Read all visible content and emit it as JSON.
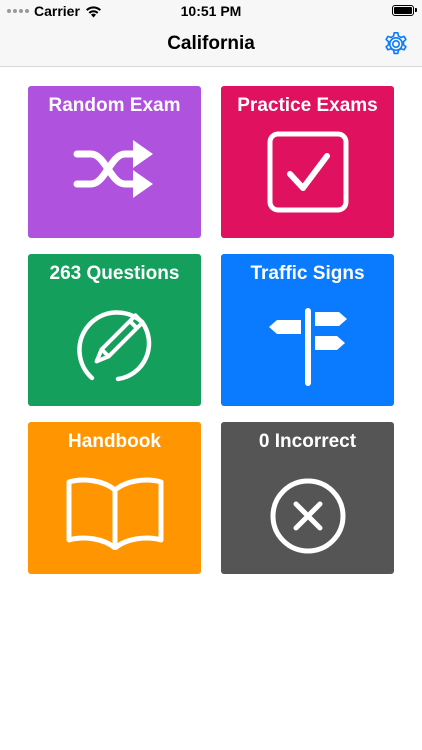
{
  "status_bar": {
    "carrier": "Carrier",
    "time": "10:51 PM",
    "icons": [
      "signal-dots-icon",
      "wifi-icon",
      "battery-icon"
    ]
  },
  "nav": {
    "title": "California",
    "settings_icon": "gear-icon"
  },
  "tiles": [
    {
      "label": "Random Exam",
      "color": "#af52de",
      "icon": "shuffle-icon"
    },
    {
      "label": "Practice Exams",
      "color": "#e0115e",
      "icon": "checkbox-icon"
    },
    {
      "label": "263 Questions",
      "color": "#14a05c",
      "icon": "pencil-circle-icon"
    },
    {
      "label": "Traffic Signs",
      "color": "#0a7bff",
      "icon": "signpost-icon"
    },
    {
      "label": "Handbook",
      "color": "#ff9500",
      "icon": "book-icon"
    },
    {
      "label": "0 Incorrect",
      "color": "#555555",
      "icon": "x-circle-icon"
    }
  ],
  "colors": {
    "accent": "#0a7bff",
    "bar_background": "#f7f7f7"
  }
}
